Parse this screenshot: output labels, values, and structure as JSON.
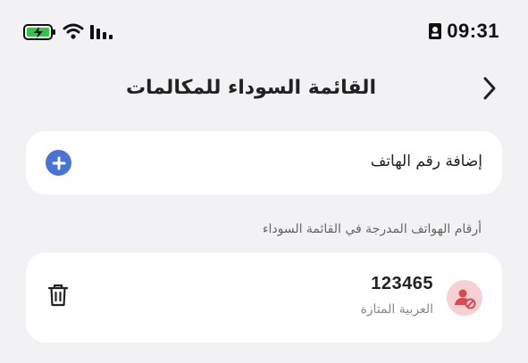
{
  "status_bar": {
    "time": "09:31",
    "icons": [
      "battery-charging-icon",
      "wifi-icon",
      "signal-icon",
      "contact-card-icon"
    ]
  },
  "header": {
    "title": "القائمة السوداء للمكالمات",
    "back_icon": "chevron-right-icon"
  },
  "add_phone": {
    "label": "إضافة رقم الهاتف",
    "icon": "plus-circle-icon"
  },
  "section": {
    "label": "أرقام الهواتف المدرجة في القائمة السوداء"
  },
  "blocked_list": [
    {
      "number": "123465",
      "label": "العربية المتازة",
      "icon": "blocked-user-icon",
      "action_icon": "trash-icon"
    }
  ],
  "colors": {
    "background": "#f2f2f4",
    "card": "#ffffff",
    "accent_blue": "#4a73d8",
    "blocked_avatar_bg": "#f6d0d2",
    "blocked_avatar_fg": "#d9484f"
  }
}
